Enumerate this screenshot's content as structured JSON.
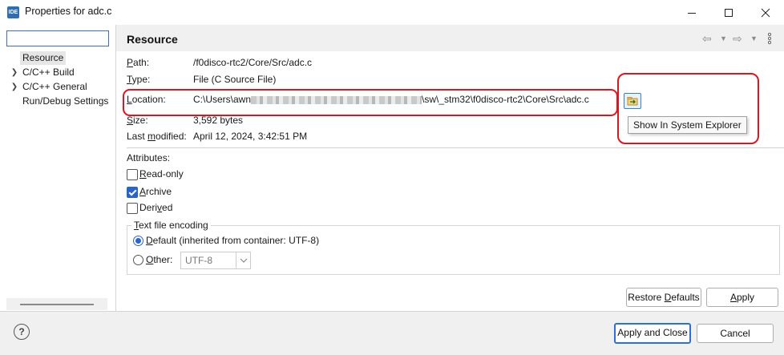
{
  "window": {
    "app_icon_text": "IDE",
    "title": "Properties for adc.c",
    "controls": [
      "minimize-icon",
      "maximize-icon",
      "close-icon"
    ]
  },
  "sidebar": {
    "filter_value": "",
    "items": [
      {
        "label": "Resource",
        "selected": true,
        "expandable": false
      },
      {
        "label": "C/C++ Build",
        "selected": false,
        "expandable": true
      },
      {
        "label": "C/C++ General",
        "selected": false,
        "expandable": true
      },
      {
        "label": "Run/Debug Settings",
        "selected": false,
        "expandable": false
      }
    ]
  },
  "page": {
    "title": "Resource",
    "nav_icons": [
      "back-arrow-icon",
      "chevron-down-icon",
      "forward-arrow-icon",
      "chevron-down-icon",
      "kebab-menu-icon"
    ],
    "path": {
      "label_u": "P",
      "label_rest": "ath:",
      "value": "/f0disco-rtc2/Core/Src/adc.c"
    },
    "type": {
      "label_pre": "",
      "label_u": "T",
      "label_rest": "ype:",
      "value": "File  (C Source File)"
    },
    "location": {
      "label_u": "L",
      "label_rest": "ocation:",
      "value_prefix": "C:\\Users\\awn",
      "value_suffix": "\\sw\\_stm32\\f0disco-rtc2\\Core\\Src\\adc.c"
    },
    "size": {
      "label_u": "S",
      "label_rest": "ize:",
      "value": "3,592  bytes"
    },
    "last_modified": {
      "label_pre": "Last ",
      "label_u": "m",
      "label_rest": "odified:",
      "value": "April 12, 2024, 3:42:51 PM"
    },
    "show_in_explorer_tooltip": "Show In System Explorer",
    "attributes_label": "Attributes:",
    "attributes": [
      {
        "pre": "",
        "u": "R",
        "rest": "ead-only",
        "checked": false
      },
      {
        "pre": "",
        "u": "A",
        "rest": "rchive",
        "checked": true
      },
      {
        "pre": "Deri",
        "u": "v",
        "rest": "ed",
        "checked": false
      }
    ],
    "encoding": {
      "group_label_u": "T",
      "group_label_rest": "ext file encoding",
      "default_u": "D",
      "default_rest": "efault (inherited from container: UTF-8)",
      "default_selected": true,
      "other_u": "O",
      "other_rest": "ther:",
      "other_value": "UTF-8"
    },
    "restore_defaults": {
      "pre": "Restore ",
      "u": "D",
      "rest": "efaults"
    },
    "apply": {
      "u": "A",
      "rest": "pply"
    }
  },
  "footer": {
    "help": "?",
    "apply_close_label": "Apply and Close",
    "cancel_label": "Cancel"
  },
  "colors": {
    "highlight": "#e0141e",
    "accent": "#2965c9",
    "header_bg": "#f0f0f0"
  }
}
